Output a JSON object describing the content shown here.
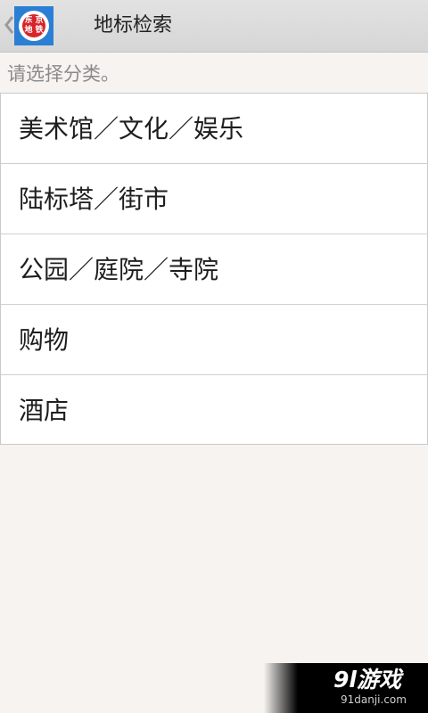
{
  "header": {
    "title": "地标检索",
    "back_icon": "chevron-left-icon",
    "logo": {
      "glyphs": [
        "东",
        "京",
        "地",
        "铁"
      ],
      "colors": {
        "tile": "#2a7fd4",
        "seal": "#d8232a"
      }
    }
  },
  "prompt": "请选择分类。",
  "categories": [
    {
      "label": "美术馆／文化／娱乐"
    },
    {
      "label": "陆标塔／街市"
    },
    {
      "label": "公园／庭院／寺院"
    },
    {
      "label": "购物"
    },
    {
      "label": "酒店"
    }
  ],
  "watermark": {
    "logo_text": "9l游戏",
    "url": "91danji.com"
  }
}
